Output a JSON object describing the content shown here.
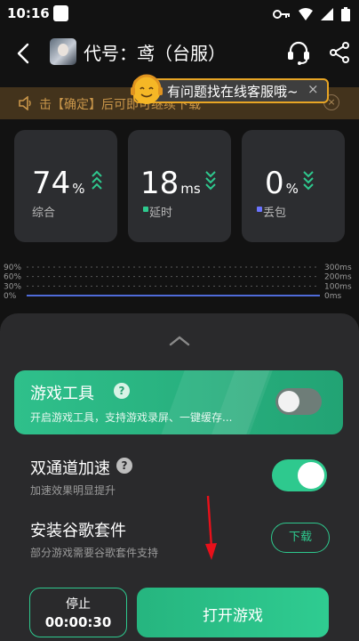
{
  "status_bar": {
    "time": "10:16"
  },
  "nav": {
    "title": "代号：鸢（台服）"
  },
  "banner": {
    "text": "击【确定】后可即可继续下载",
    "close_glyph": "×"
  },
  "cs_bubble": {
    "text": "有问题找在线客服哦~",
    "close_glyph": "×"
  },
  "stats": [
    {
      "value": "74",
      "unit": "%",
      "label": "综合",
      "dot_color": ""
    },
    {
      "value": "18",
      "unit": "ms",
      "label": "延时",
      "dot_color": "#2ec98e"
    },
    {
      "value": "0",
      "unit": "%",
      "label": "丢包",
      "dot_color": "#6b74ff"
    }
  ],
  "chart_data": {
    "type": "line",
    "left_axis_ticks": [
      "90%",
      "60%",
      "30%",
      "0%"
    ],
    "right_axis_ticks": [
      "300ms",
      "200ms",
      "100ms",
      "0ms"
    ],
    "series": [
      {
        "values": [
          0,
          0,
          0,
          0,
          0,
          0,
          0,
          0,
          0,
          0
        ],
        "color": "#4f6bd8"
      }
    ]
  },
  "sheet": {
    "tool": {
      "title": "游戏工具",
      "help": "?",
      "subtitle": "开启游戏工具，支持游戏录屏、一键缓存...",
      "enabled": false
    },
    "dual_channel": {
      "title": "双通道加速",
      "help": "?",
      "subtitle": "加速效果明显提升",
      "enabled": true
    },
    "google": {
      "title": "安装谷歌套件",
      "subtitle": "部分游戏需要谷歌套件支持",
      "button": "下载"
    },
    "stop_button": {
      "label": "停止",
      "time": "00:00:30"
    },
    "play_button": {
      "label": "打开游戏"
    }
  },
  "colors": {
    "accent": "#2ec98e",
    "banner_text": "#c9964a",
    "bubble_border": "#e8a524"
  }
}
